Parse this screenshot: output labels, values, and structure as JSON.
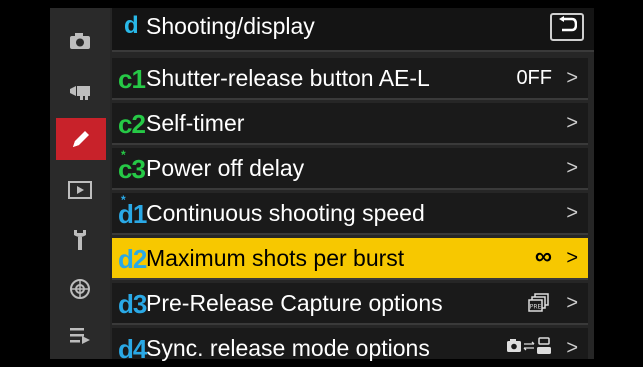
{
  "header": {
    "section_letter": "d",
    "title": "Shooting/display"
  },
  "sidebar": {
    "items": [
      {
        "icon": "camera-icon"
      },
      {
        "icon": "movie-camera-icon"
      },
      {
        "icon": "pencil-icon"
      },
      {
        "icon": "playback-icon"
      },
      {
        "icon": "wrench-icon"
      },
      {
        "icon": "network-icon"
      },
      {
        "icon": "my-menu-icon"
      }
    ],
    "active_index": 2
  },
  "menu": {
    "items": [
      {
        "code": "c1",
        "label": "Shutter-release button AE-L",
        "value": "0FF",
        "color": "#26c946"
      },
      {
        "code": "c2",
        "label": "Self-timer",
        "value": "",
        "color": "#26c946"
      },
      {
        "code": "c3",
        "label": "Power off delay",
        "value": "",
        "color": "#26c946",
        "starred": true
      },
      {
        "code": "d1",
        "label": "Continuous shooting speed",
        "value": "",
        "color": "#2aa9e6",
        "starred": true
      },
      {
        "code": "d2",
        "label": "Maximum shots per burst",
        "value": "∞",
        "color": "#2aa9e6",
        "selected": true
      },
      {
        "code": "d3",
        "label": "Pre-Release Capture options",
        "value": "PRE",
        "color": "#2aa9e6"
      },
      {
        "code": "d4",
        "label": "Sync. release mode options",
        "value": "",
        "color": "#2aa9e6"
      }
    ],
    "chevron": ">"
  },
  "colors": {
    "selected_bg": "#f7c800",
    "active_tab": "#c8222a",
    "d_section": "#2aa9e6",
    "c_section": "#26c946"
  }
}
